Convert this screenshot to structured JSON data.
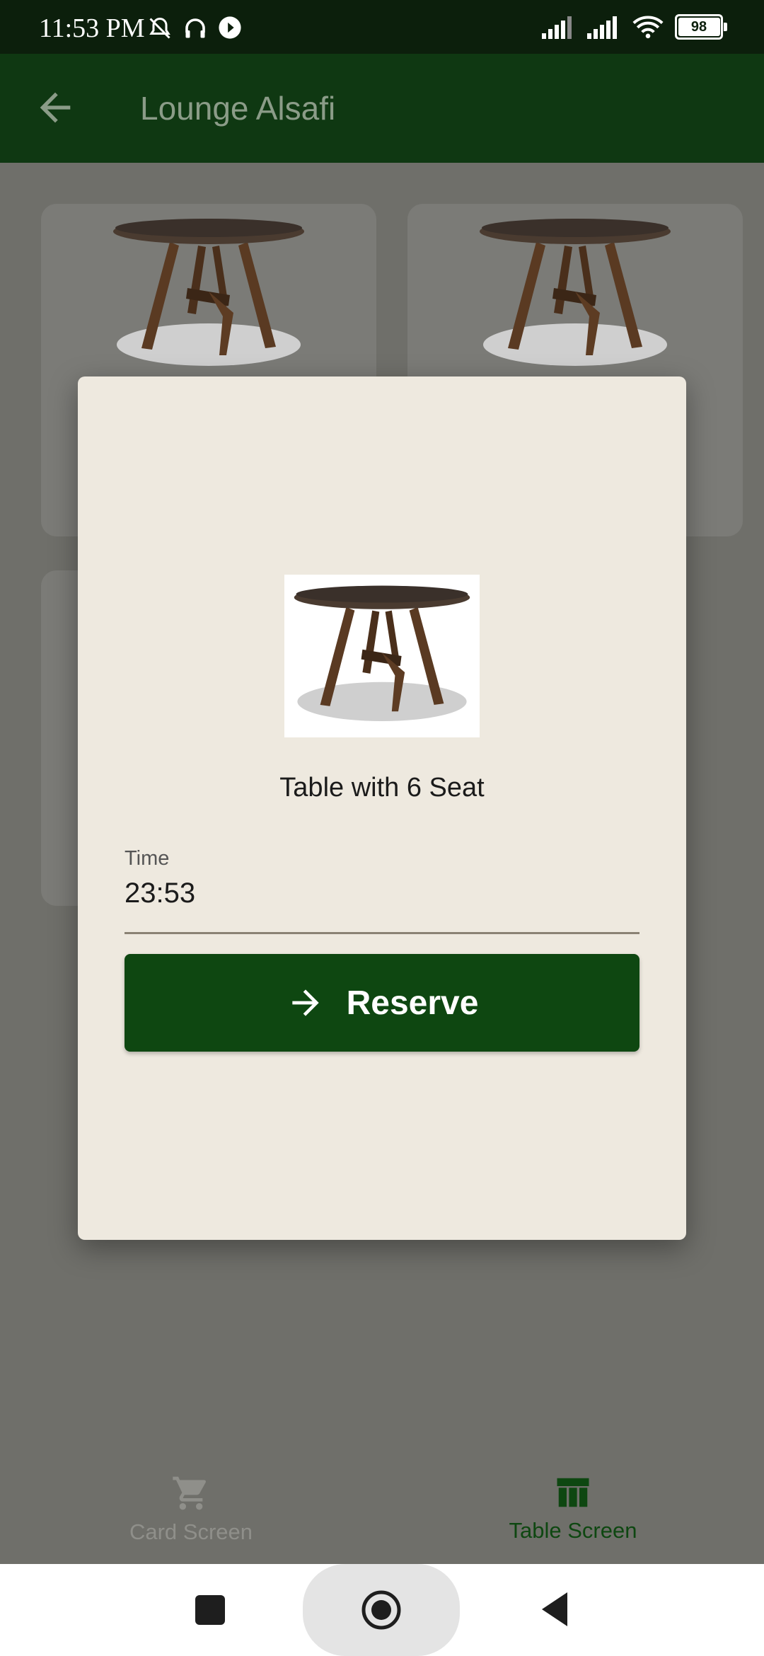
{
  "status_bar": {
    "time": "11:53 PM",
    "battery": "98"
  },
  "app_bar": {
    "title": "Lounge Alsafi"
  },
  "dialog": {
    "title": "Table with 6 Seat",
    "time_label": "Time",
    "time_value": "23:53",
    "reserve_label": "Reserve"
  },
  "bottom_nav": {
    "items": [
      {
        "label": "Card Screen",
        "icon": "cart-icon",
        "selected": false
      },
      {
        "label": "Table Screen",
        "icon": "table-icon",
        "selected": true
      }
    ]
  },
  "colors": {
    "app_bar": "#0f3812",
    "accent": "#0e4711",
    "dialog_bg": "#eee9df"
  }
}
